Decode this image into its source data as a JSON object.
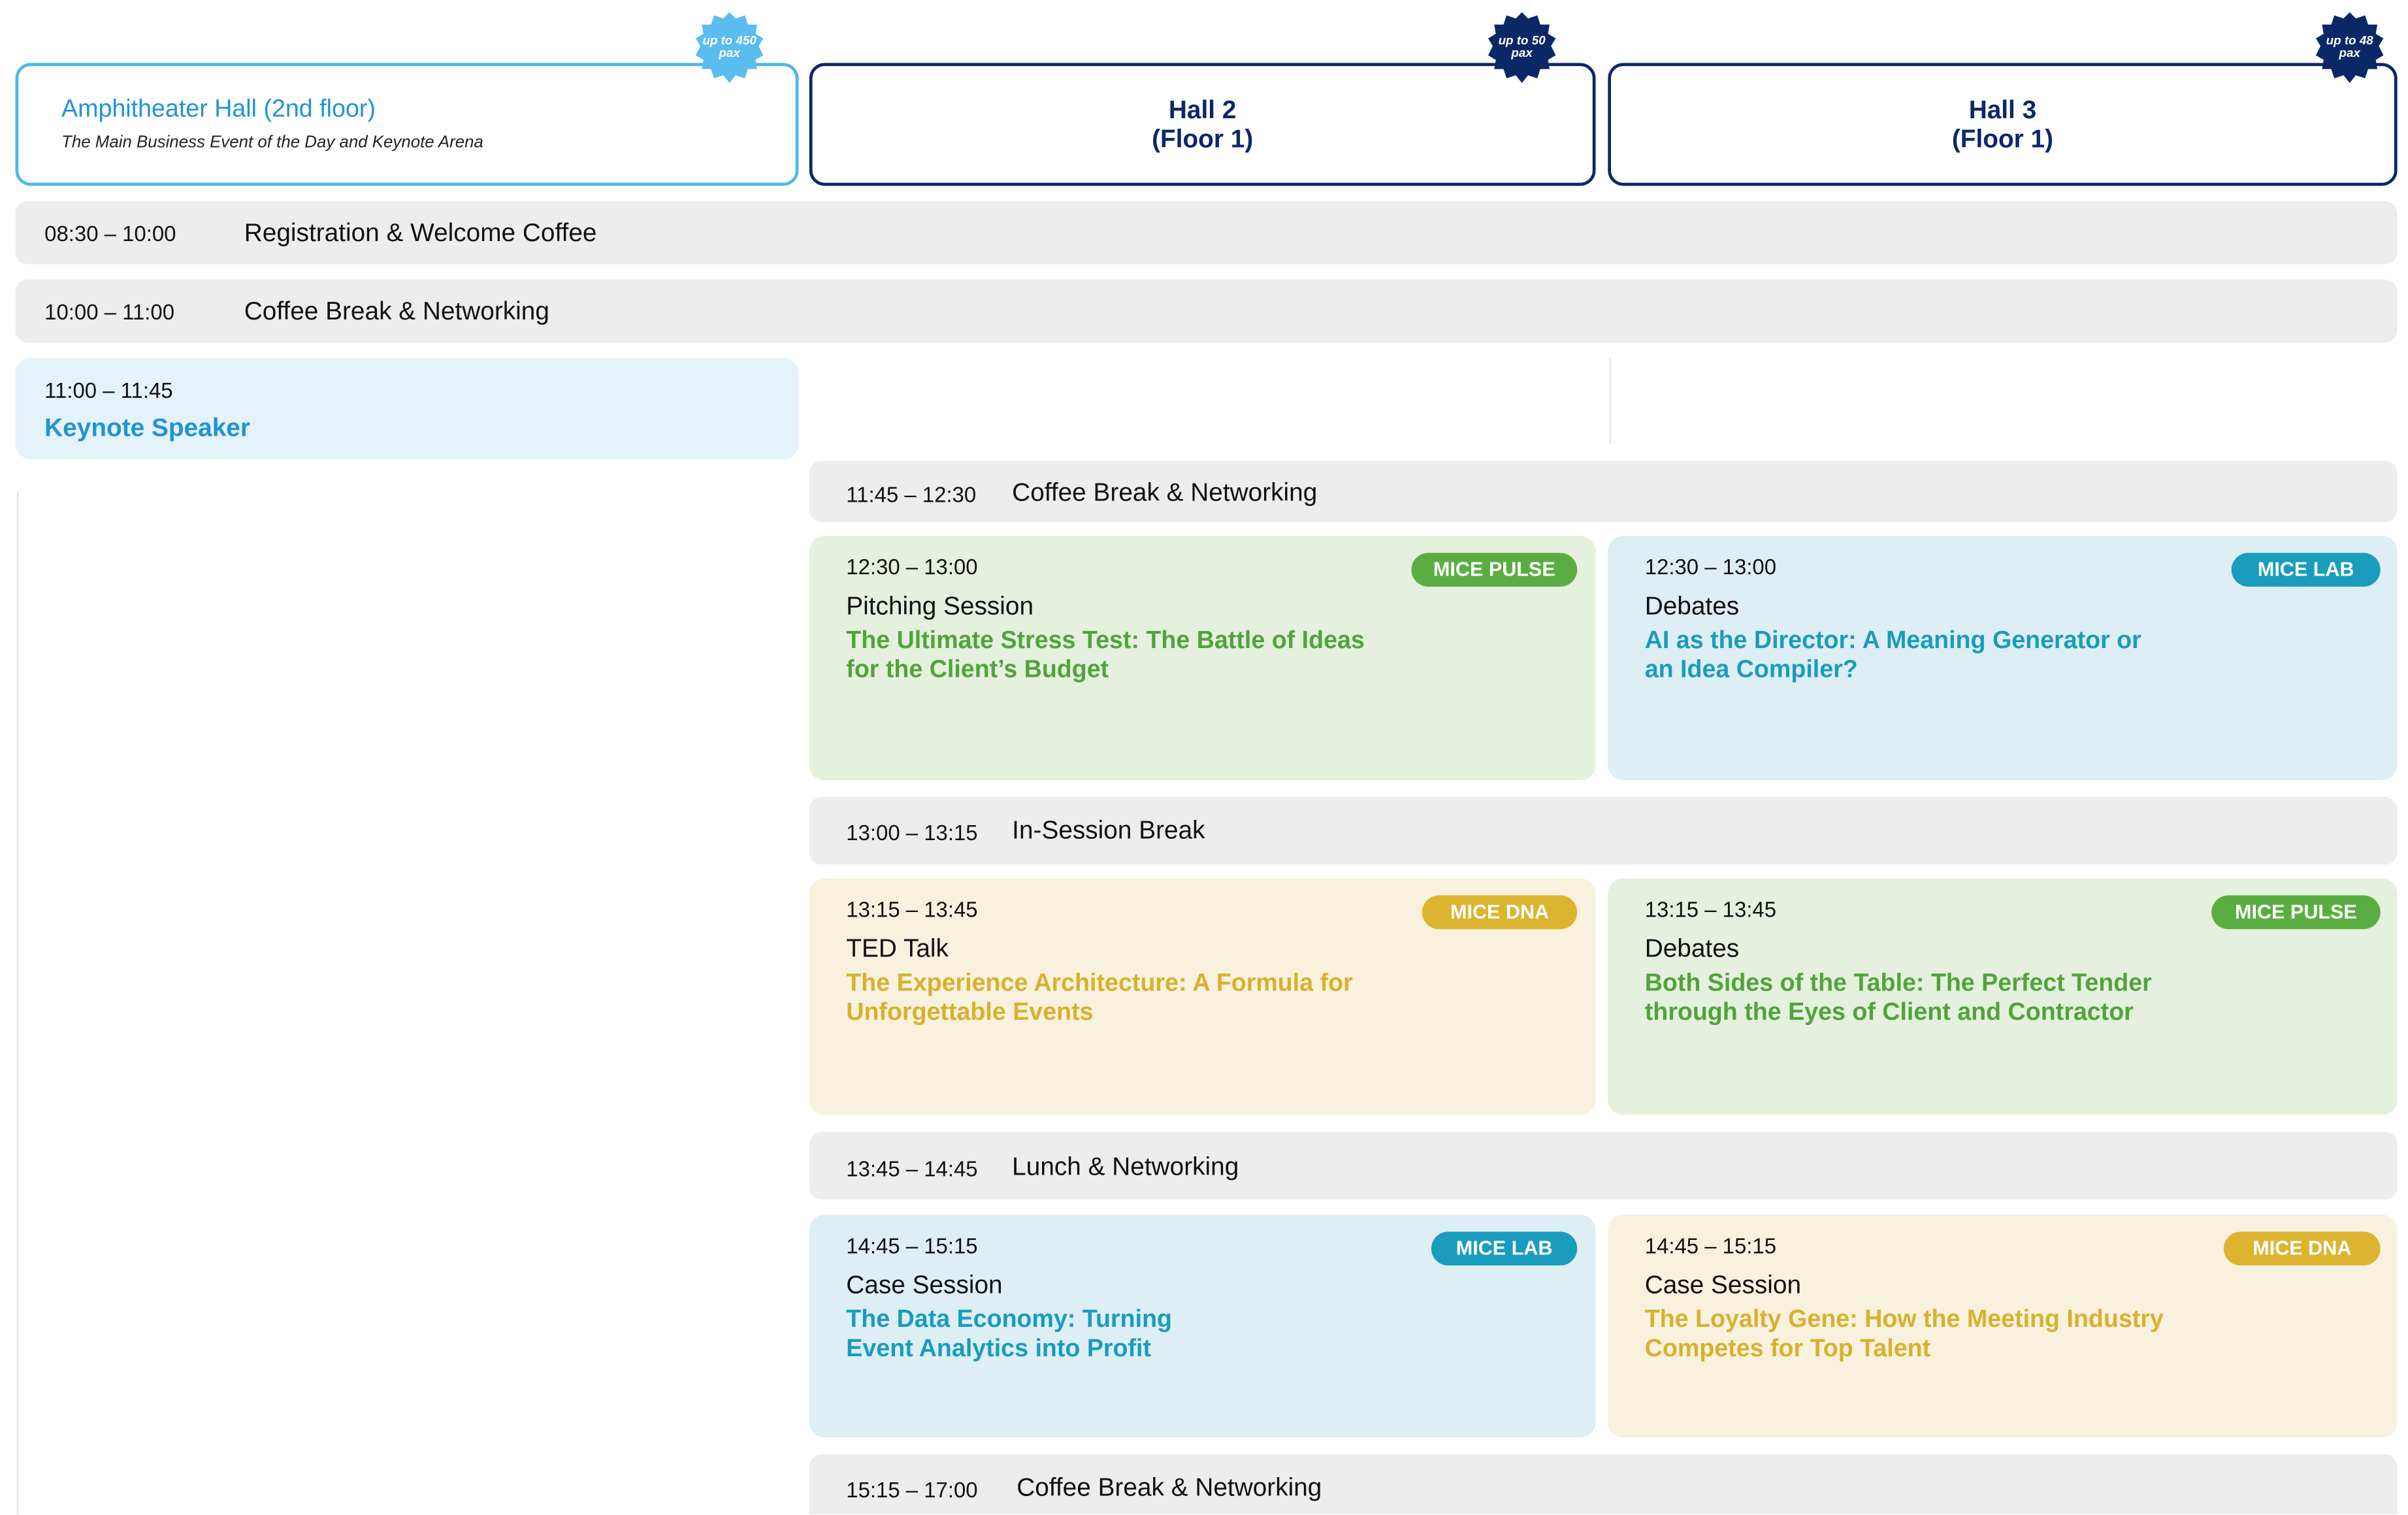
{
  "halls": [
    {
      "name": "Amphitheater Hall (2nd floor)",
      "subtitle": "The Main Business Event of the Day and Keynote Arena",
      "capacity": "up to 450 pax",
      "badge_color": "#5bbcef"
    },
    {
      "name_line1": "Hall 2",
      "name_line2": "(Floor 1)",
      "capacity": "up to 50 pax",
      "badge_color": "#0b2866"
    },
    {
      "name_line1": "Hall 3",
      "name_line2": "(Floor 1)",
      "capacity": "up to 48 pax",
      "badge_color": "#0b2866"
    }
  ],
  "full_rows": [
    {
      "time": "08:30 – 10:00",
      "label": "Registration & Welcome Coffee"
    },
    {
      "time": "10:00 – 11:00",
      "label": "Coffee Break & Networking"
    }
  ],
  "keynote": {
    "time": "11:00 – 11:45",
    "title": "Keynote Speaker"
  },
  "side_rows": [
    {
      "time": "11:45 – 12:30",
      "label": "Coffee Break & Networking"
    },
    {
      "time": "13:00 – 13:15",
      "label": "In-Session Break"
    },
    {
      "time": "13:45 – 14:45",
      "label": "Lunch & Networking"
    },
    {
      "time": "15:15 – 17:00",
      "label": "Coffee Break & Networking"
    }
  ],
  "sessions": [
    {
      "time": "12:30 – 13:00",
      "type": "Pitching Session",
      "title": "The Ultimate Stress Test: The Battle of Ideas for the Client’s Budget",
      "tag": "MICE PULSE",
      "hall": "Hall 2"
    },
    {
      "time": "12:30 – 13:00",
      "type": "Debates",
      "title": "AI as the Director: A Meaning Generator or an Idea Compiler?",
      "tag": "MICE LAB",
      "hall": "Hall 3"
    },
    {
      "time": "13:15 – 13:45",
      "type": "TED Talk",
      "title": "The Experience Architecture: A Formula for Unforgettable Events",
      "tag": "MICE DNA",
      "hall": "Hall 2"
    },
    {
      "time": "13:15 – 13:45",
      "type": "Debates",
      "title": "Both Sides of the Table: The Perfect Tender through the Eyes of Client and Contractor",
      "tag": "MICE PULSE",
      "hall": "Hall 3"
    },
    {
      "time": "14:45 – 15:15",
      "type": "Case Session",
      "title": "The Data Economy: Turning Event Analytics into Profit",
      "tag": "MICE LAB",
      "hall": "Hall 2"
    },
    {
      "time": "14:45 – 15:15",
      "type": "Case Session",
      "title": "The Loyalty Gene: How the Meeting Industry Competes for Top Talent",
      "tag": "MICE DNA",
      "hall": "Hall 3"
    }
  ],
  "tag_colors": {
    "MICE PULSE": "#5aae41",
    "MICE LAB": "#1a9cbc",
    "MICE DNA": "#ddb42f"
  }
}
